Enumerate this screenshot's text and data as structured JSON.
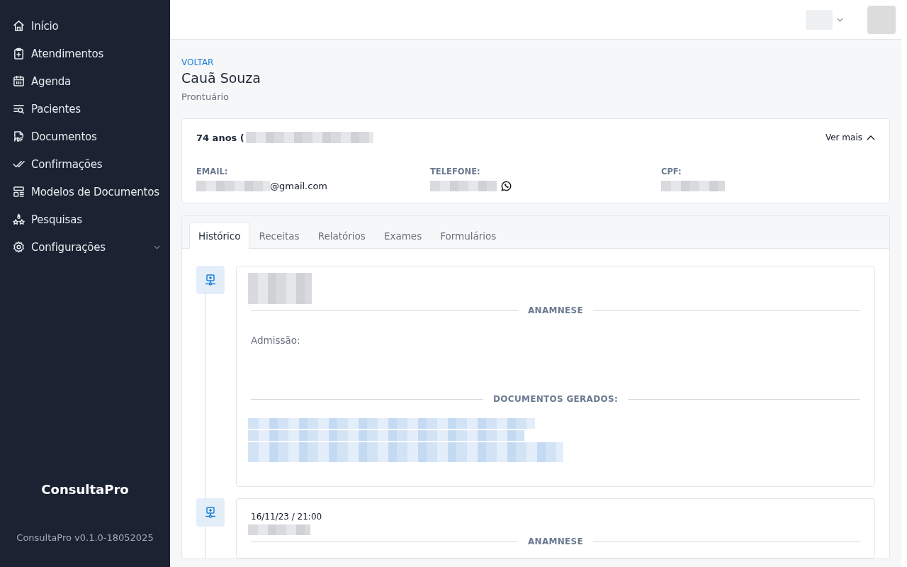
{
  "sidebar": {
    "items": [
      {
        "label": "Início",
        "kind": "home",
        "selected": false,
        "expandable": false
      },
      {
        "label": "Atendimentos",
        "kind": "clipboard",
        "selected": false,
        "expandable": false
      },
      {
        "label": "Agenda",
        "kind": "calendar",
        "selected": false,
        "expandable": false
      },
      {
        "label": "Pacientes",
        "kind": "searchlist",
        "selected": false,
        "expandable": false
      },
      {
        "label": "Documentos",
        "kind": "pdf",
        "selected": false,
        "expandable": false
      },
      {
        "label": "Confirmações",
        "kind": "checks",
        "selected": false,
        "expandable": false
      },
      {
        "label": "Modelos de Documentos",
        "kind": "template",
        "selected": false,
        "expandable": false
      },
      {
        "label": "Pesquisas",
        "kind": "shapes",
        "selected": false,
        "expandable": false
      },
      {
        "label": "Configurações",
        "kind": "gear",
        "selected": false,
        "expandable": true
      }
    ],
    "brand": "ConsultaPro",
    "version": "ConsultaPro v0.1.0-18052025"
  },
  "header": {
    "back": "VOLTAR",
    "patient": "Cauã Souza",
    "subtitle": "Prontuário"
  },
  "patient_card": {
    "age": "74 anos (",
    "more": "Ver mais",
    "expanded": true,
    "fields": [
      {
        "label": "EMAIL:",
        "value": "@gmail.com",
        "kind": "email"
      },
      {
        "label": "TELEFONE:",
        "kind": "phone"
      },
      {
        "label": "CPF:",
        "kind": "plain"
      }
    ]
  },
  "tabs": [
    {
      "label": "Histórico",
      "selected": true
    },
    {
      "label": "Receitas",
      "selected": false
    },
    {
      "label": "Relatórios",
      "selected": false
    },
    {
      "label": "Exames",
      "selected": false
    },
    {
      "label": "Formulários",
      "selected": false
    }
  ],
  "timeline": [
    {
      "sections": [
        {
          "title": "ANAMNESE",
          "kind": "text",
          "text": "Admissão:"
        },
        {
          "title": "DOCUMENTOS GERADOS:",
          "kind": "documents"
        }
      ]
    },
    {
      "date": "16/11/23 / 21:00",
      "sections": [
        {
          "title": "ANAMNESE",
          "kind": "text"
        }
      ]
    }
  ]
}
